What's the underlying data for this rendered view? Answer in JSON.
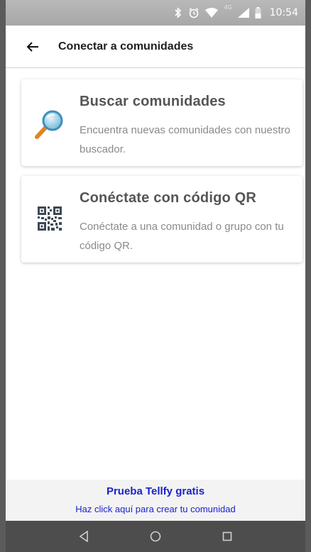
{
  "status_bar": {
    "time": "10:54",
    "network_label": "4G",
    "icons": [
      "bluetooth-icon",
      "alarm-icon",
      "wifi-icon",
      "signal-icon",
      "battery-icon"
    ]
  },
  "app_bar": {
    "title": "Conectar a comunidades",
    "back_icon": "arrow-left-icon"
  },
  "cards": [
    {
      "title": "Buscar comunidades",
      "description": "Encuentra nuevas comunidades con nuestro buscador.",
      "icon": "magnifier-icon"
    },
    {
      "title": "Conéctate con código QR",
      "description": "Conéctate a una comunidad o grupo con tu código QR.",
      "icon": "qr-code-icon"
    }
  ],
  "promo": {
    "title": "Prueba Tellfy gratis",
    "subtitle": "Haz click aquí para crear tu comunidad"
  },
  "colors": {
    "link_blue": "#1a23c9",
    "status_bar": "#b0b0b0",
    "nav_bar": "#4d4d4d",
    "promo_bg": "#f3f3f3"
  },
  "navigation_bar": {
    "buttons": [
      "back-triangle-icon",
      "home-circle-icon",
      "recents-square-icon"
    ]
  }
}
